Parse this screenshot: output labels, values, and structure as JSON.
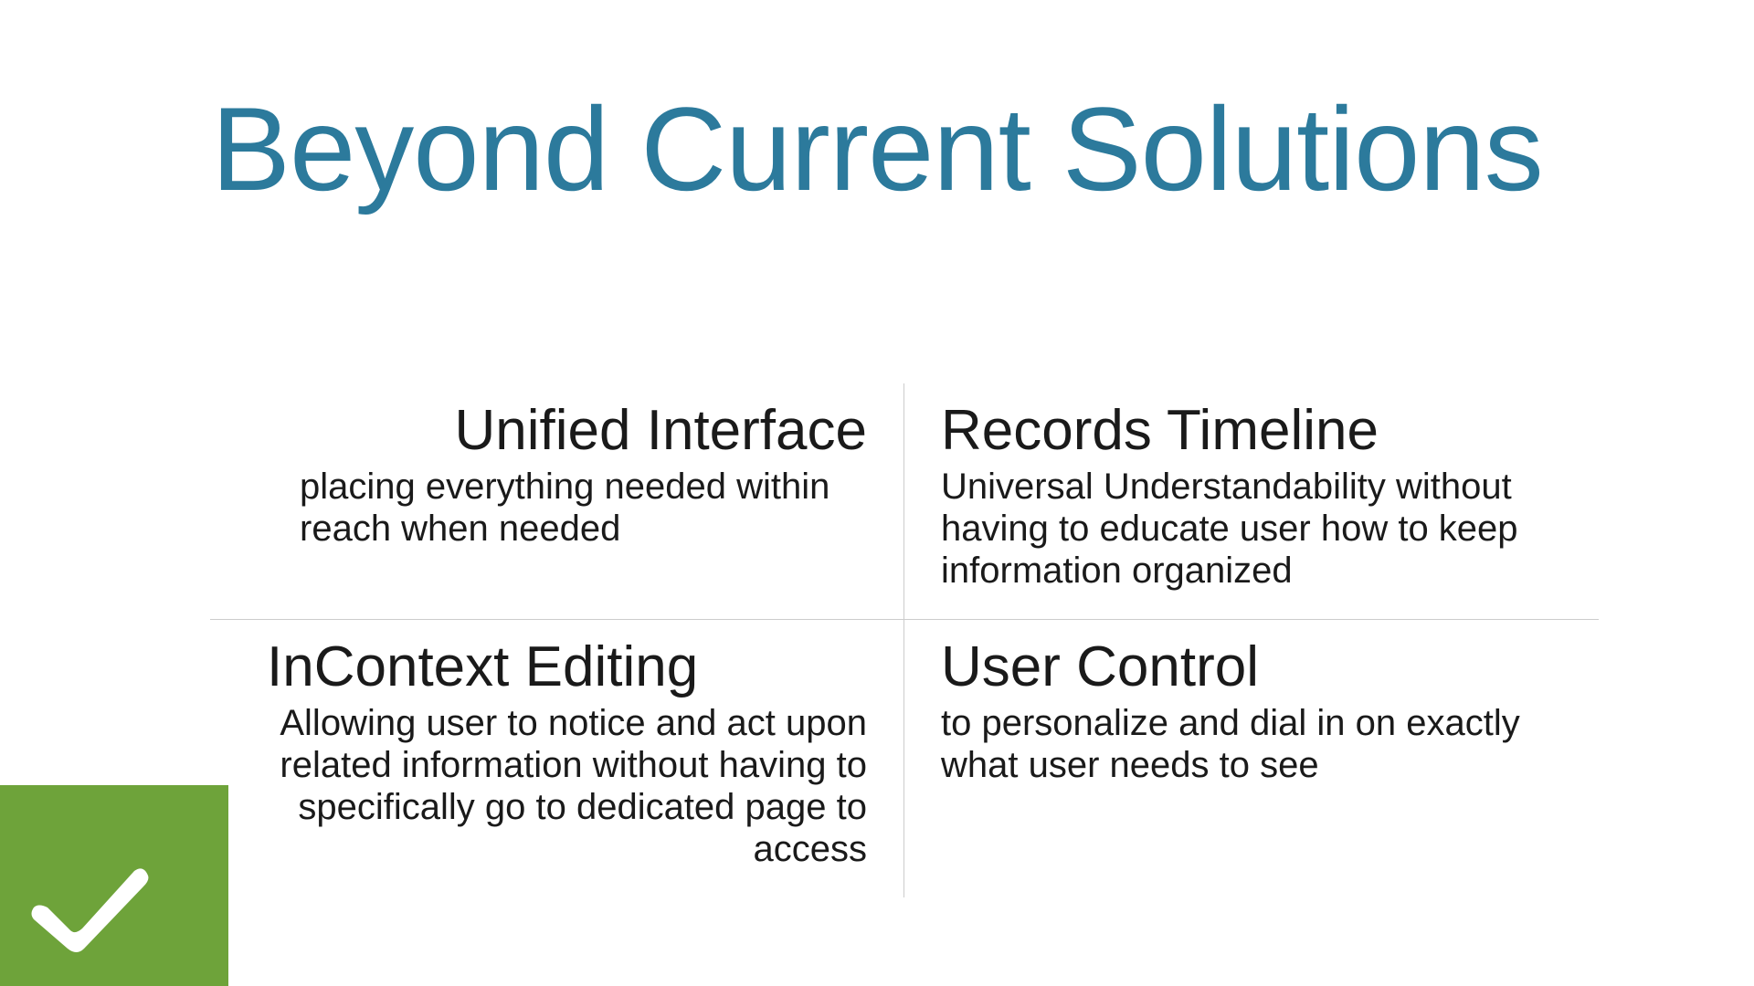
{
  "title": "Beyond Current Solutions",
  "cells": [
    {
      "heading": "Unified Interface",
      "description": "placing everything needed within reach when needed"
    },
    {
      "heading": "Records Timeline",
      "description": "Universal Understandability without having to educate user how to keep information organized"
    },
    {
      "heading": "InContext Editing",
      "description": "Allowing user to notice and act upon related information without having to specifically go to dedicated page to access"
    },
    {
      "heading": "User Control",
      "description": "to personalize and dial in on exactly what user needs to see"
    }
  ],
  "colors": {
    "title": "#2c7a9c",
    "badge": "#6ea33a"
  }
}
